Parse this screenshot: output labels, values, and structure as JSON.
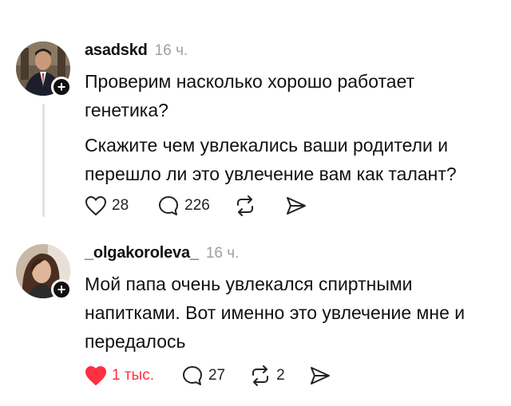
{
  "posts": [
    {
      "username": "asadskd",
      "time": "16 ч.",
      "paragraphs": [
        "Проверим насколько хорошо работает генетика?",
        "Скажите чем увлекались ваши родители и перешло ли это увлечение вам как талант?"
      ],
      "likes": "28",
      "replies": "226",
      "reposts": "",
      "liked": false,
      "icons": {
        "like": "heart-outline-icon",
        "reply": "comment-icon",
        "repost": "repost-icon",
        "share": "send-icon"
      }
    },
    {
      "username": "_olgakoroleva_",
      "time": "16 ч.",
      "paragraphs": [
        "Мой папа очень увлекался спиртными напитками. Вот именно это увлечение мне и передалось"
      ],
      "likes": "1 тыс.",
      "replies": "27",
      "reposts": "2",
      "liked": true,
      "icons": {
        "like": "heart-filled-icon",
        "reply": "comment-icon",
        "repost": "repost-icon",
        "share": "send-icon"
      }
    }
  ],
  "colors": {
    "like_active": "#ff3040",
    "muted": "#a0a0a0",
    "text": "#111111",
    "thread_line": "#e2e2e2"
  }
}
